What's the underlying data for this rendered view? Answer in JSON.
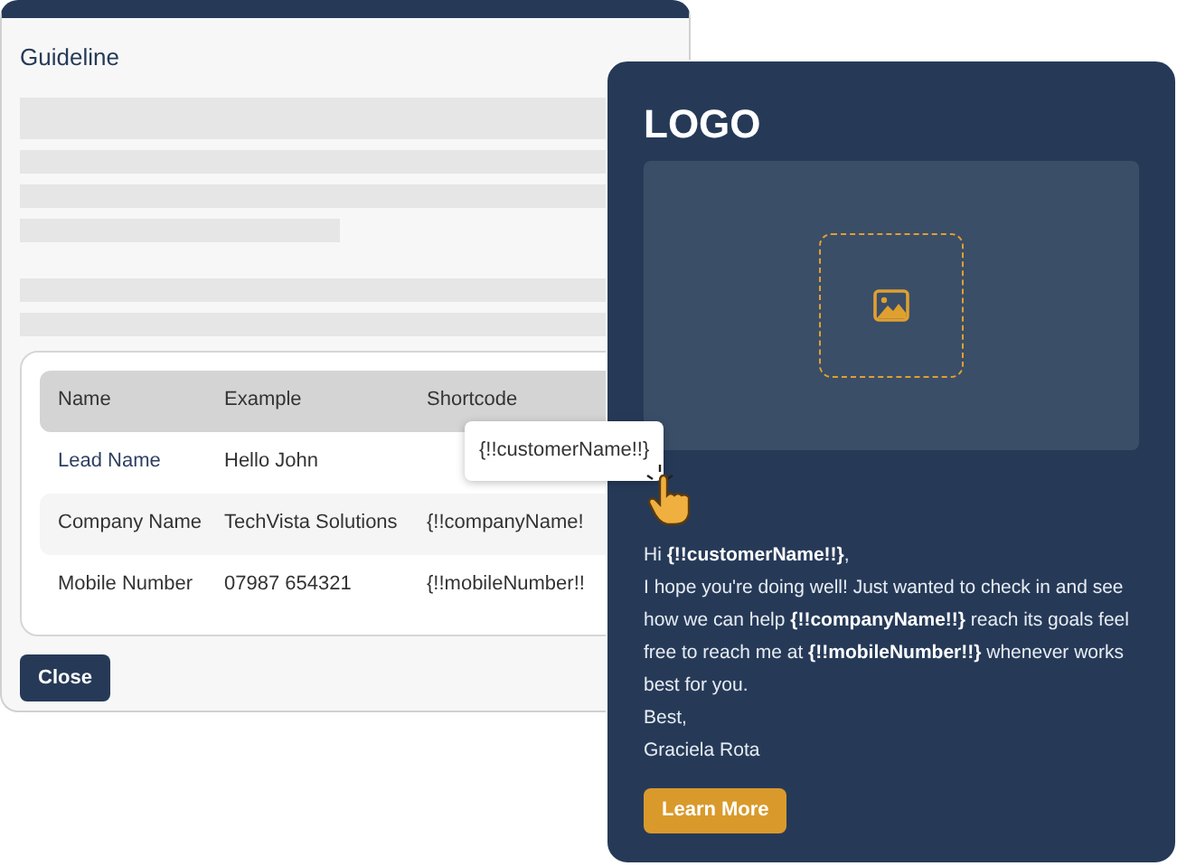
{
  "guideline": {
    "title": "Guideline",
    "table": {
      "columns": [
        "Name",
        "Example",
        "Shortcode"
      ],
      "rows": [
        {
          "kind": "link",
          "name": "Lead Name",
          "example": "Hello John"
        },
        {
          "kind": "text",
          "name": "Company Name",
          "example": "TechVista Solutions",
          "shortcode": "{!!companyName!"
        },
        {
          "kind": "text",
          "name": "Mobile Number",
          "example": "07987 654321",
          "shortcode": "{!!mobileNumber!!"
        }
      ]
    },
    "close_button": "Close"
  },
  "tooltip": {
    "text": "{!!customerName!!}"
  },
  "email": {
    "logo": "LOGO",
    "greeting": "Hi **{!!customerName!!}**,",
    "body": "I hope you're doing well! Just wanted to check in and see how we can help **{!!companyName!!}** reach its goals feel free to reach me at **{!!mobileNumber!!}** whenever works best for you.",
    "closing": "Best,",
    "signature": "Graciela Rota",
    "button": "Learn More"
  }
}
